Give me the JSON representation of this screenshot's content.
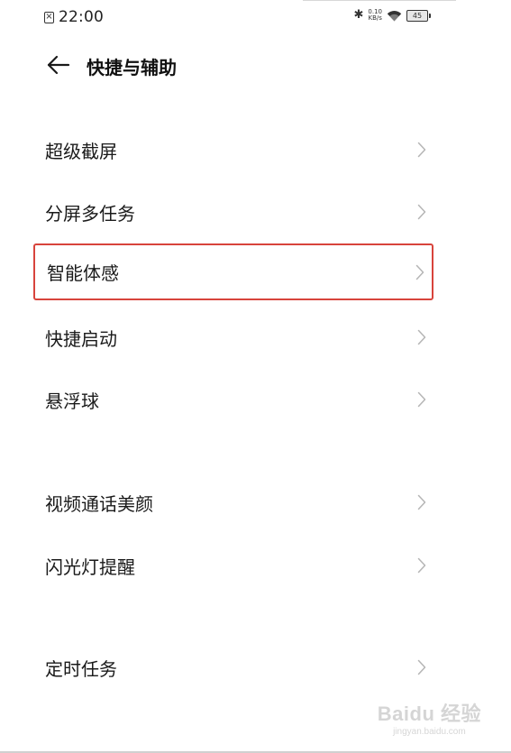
{
  "status_bar": {
    "time": "22:00",
    "net_speed_value": "0.10",
    "net_speed_unit": "KB/s",
    "battery_level": "45",
    "icons": [
      "sim-card-icon",
      "bluetooth-icon",
      "wifi-icon",
      "battery-icon"
    ]
  },
  "header": {
    "title": "快捷与辅助",
    "back_icon": "back-arrow-icon"
  },
  "settings": {
    "items": [
      {
        "label": "超级截屏"
      },
      {
        "label": "分屏多任务"
      },
      {
        "label": "智能体感"
      },
      {
        "label": "快捷启动"
      },
      {
        "label": "悬浮球"
      },
      {
        "label": "视频通话美颜"
      },
      {
        "label": "闪光灯提醒"
      },
      {
        "label": "定时任务"
      }
    ],
    "highlighted_item": "智能体感",
    "chevron_icon": "chevron-right-icon"
  },
  "watermark": {
    "main": "Baidu 经验",
    "sub": "jingyan.baidu.com"
  },
  "colors": {
    "highlight_border": "#d8443c",
    "background": "#ffffff",
    "text": "#1a1a1a",
    "chevron": "#b5b5b5"
  }
}
